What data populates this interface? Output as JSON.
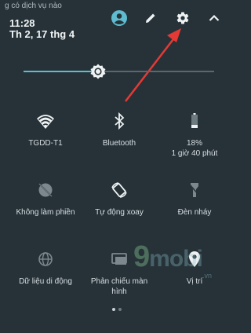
{
  "status": {
    "carrier_text": "g có dịch vụ nào",
    "time": "11:28",
    "date": "Th 2, 17 thg 4"
  },
  "header_icons": [
    "account-icon",
    "edit-icon",
    "settings-icon",
    "collapse-icon"
  ],
  "brightness": {
    "level": 0.39
  },
  "tiles": [
    {
      "label": "TGDD-T1",
      "icon": "wifi-icon"
    },
    {
      "label": "Bluetooth",
      "icon": "bluetooth-icon"
    },
    {
      "label": "18%",
      "sub": "1 giờ 40 phút",
      "icon": "battery-icon"
    },
    {
      "label": "Không làm phiền",
      "icon": "do-not-disturb-icon"
    },
    {
      "label": "Tự động xoay",
      "icon": "auto-rotate-icon"
    },
    {
      "label": "Đèn nháy",
      "icon": "flashlight-icon"
    },
    {
      "label": "Dữ liệu di động",
      "icon": "mobile-data-icon"
    },
    {
      "label": "Phản chiếu màn",
      "sub": "hình",
      "icon": "screen-cast-icon"
    },
    {
      "label": "Vị trí",
      "icon": "location-icon"
    }
  ],
  "watermark": {
    "brand": "mobi",
    "digit": "9",
    "domain": ".vn"
  },
  "pager": {
    "pages": 2,
    "current": 1
  },
  "colors": {
    "background": "#263238",
    "accent": "#5fbcd0",
    "arrow": "#e53935"
  }
}
